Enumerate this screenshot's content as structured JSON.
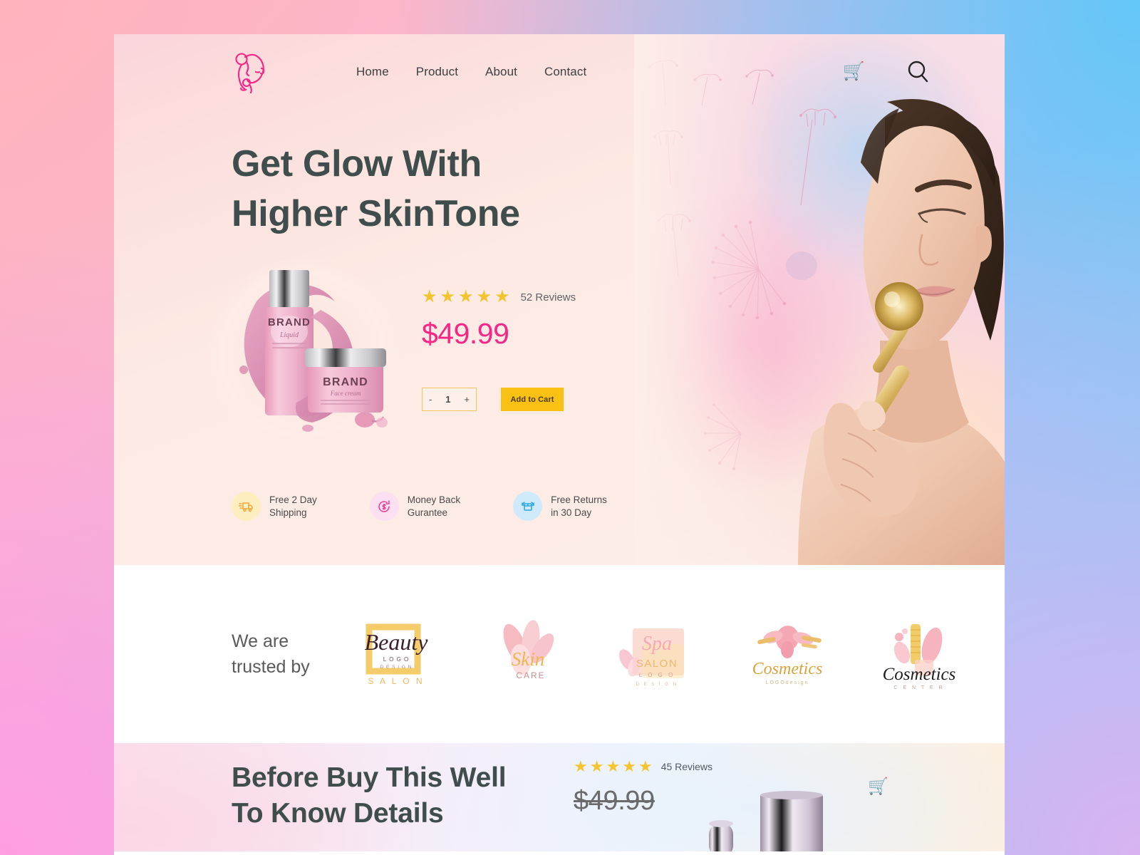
{
  "brand": {
    "logo_icon": "woman-face-logo-icon",
    "logo_color": "#f72585"
  },
  "nav": {
    "links": [
      {
        "label": "Home",
        "name": "nav-link-home"
      },
      {
        "label": "Product",
        "name": "nav-link-product"
      },
      {
        "label": "About",
        "name": "nav-link-about"
      },
      {
        "label": "Contact",
        "name": "nav-link-contact"
      }
    ],
    "cart_icon": "shopping-cart-icon",
    "cart_glyph": "🛒",
    "search_icon": "search-icon"
  },
  "hero": {
    "headline_line1": "Get Glow With",
    "headline_line2": "Higher SkinTone",
    "headline_color": "#3f4d4d",
    "product_image": "pink-cosmetic-bottle-and-jar",
    "product_label": "BRAND",
    "rating": {
      "stars": 5,
      "star_glyph": "★",
      "star_color": "#f4c430",
      "reviews_text": "52 Reviews"
    },
    "price": "$49.99",
    "price_color": "#f72585",
    "quantity": {
      "decrement_label": "-",
      "value": "1",
      "increment_label": "+"
    },
    "add_to_cart_label": "Add to Cart",
    "add_to_cart_color": "#f9c114",
    "photo_alt": "woman-using-gold-face-roller",
    "features": [
      {
        "icon": "delivery-truck-icon",
        "line1": "Free 2 Day",
        "line2": "Shipping",
        "tint": "amber"
      },
      {
        "icon": "money-back-icon",
        "line1": "Money Back",
        "line2": "Gurantee",
        "tint": "pink"
      },
      {
        "icon": "return-box-icon",
        "line1": "Free Returns",
        "line2": "in 30 Day",
        "tint": "blue"
      }
    ]
  },
  "trusted": {
    "label_line1": "We are",
    "label_line2": "trusted by",
    "brands": [
      {
        "name": "Beauty",
        "sub1": "L O G O",
        "sub2": "D E S I G N",
        "sub3": "S A L O N"
      },
      {
        "name": "Skin",
        "sub1": "CARE",
        "sub2": "",
        "sub3": ""
      },
      {
        "name": "Spa",
        "sub1": "SALON",
        "sub2": "L O G O",
        "sub3": "D E S I G N"
      },
      {
        "name": "Cosmetics",
        "sub1": "LOGOdesign",
        "sub2": "",
        "sub3": ""
      },
      {
        "name": "Cosmetics",
        "sub1": "C E N T E R",
        "sub2": "",
        "sub3": ""
      }
    ]
  },
  "bottom": {
    "headline_line1": "Before Buy This Well",
    "headline_line2": "To Know Details",
    "rating": {
      "stars": 5,
      "star_glyph": "★",
      "reviews_text": "45 Reviews"
    },
    "price": "$49.99",
    "cart_glyph": "🛒",
    "product_image": "silver-cosmetic-bottles"
  }
}
